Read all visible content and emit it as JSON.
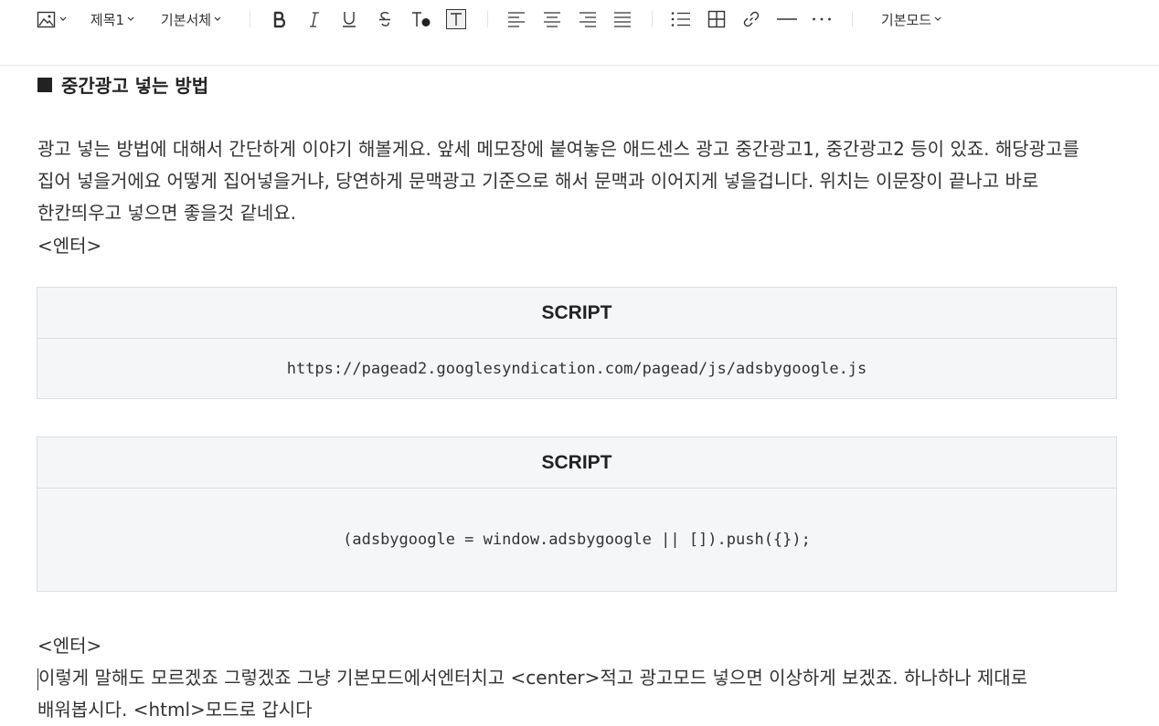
{
  "toolbar": {
    "heading_dropdown": "제목1",
    "font_dropdown": "기본서체",
    "mode_dropdown": "기본모드",
    "buttons": [
      "image-icon",
      "bold-icon",
      "italic-icon",
      "underline-icon",
      "strikethrough-icon",
      "text-color-icon",
      "text-background-icon",
      "align-left-icon",
      "align-center-icon",
      "align-right-icon",
      "align-justify-icon",
      "bullet-list-icon",
      "table-icon",
      "link-icon",
      "horizontal-rule-icon",
      "more-icon"
    ]
  },
  "editor": {
    "heading": "중간광고 넣는 방법",
    "paragraph1": "광고 넣는 방법에 대해서 간단하게 이야기 해볼게요. 앞세 메모장에 붙여놓은 애드센스 광고 중간광고1, 중간광고2 등이 있죠. 해당광고를 집어 넣을거에요 어떻게 집어넣을거냐, 당연하게 문맥광고 기준으로 해서 문맥과 이어지게 넣을겁니다. 위치는 이문장이 끝나고 바로 한칸띄우고 넣으면 좋을것 같네요.",
    "enter_tag1": "<엔터>",
    "code_block1": {
      "header": "SCRIPT",
      "code": "https://pagead2.googlesyndication.com/pagead/js/adsbygoogle.js"
    },
    "code_block2": {
      "header": "SCRIPT",
      "code": "(adsbygoogle = window.adsbygoogle || []).push({});"
    },
    "enter_tag2": "<엔터>",
    "paragraph2": "이렇게 말해도 모르겠죠 그렇겠죠 그냥 기본모드에서엔터치고 <center>적고 광고모드 넣으면 이상하게 보겠죠. 하나하나 제대로 배워봅시다. <html>모드로 갑시다"
  },
  "colors": {
    "code_bg": "#f5f6f8",
    "code_border": "#dcdee2",
    "text": "#333333"
  }
}
